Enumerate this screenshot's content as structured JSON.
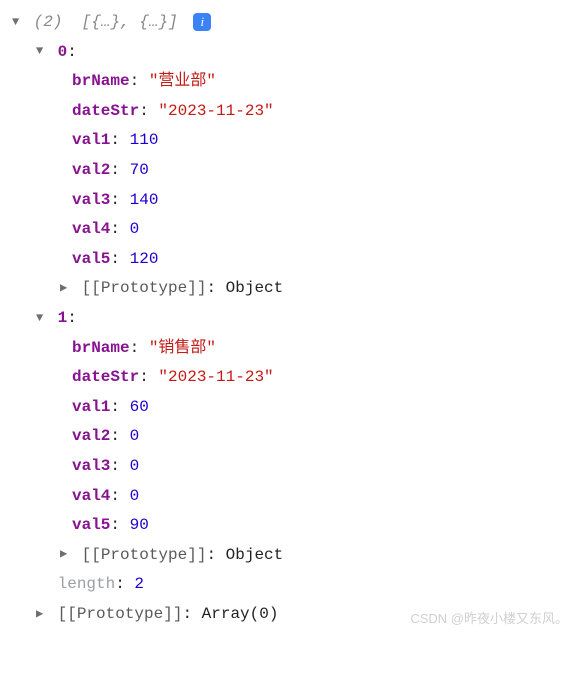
{
  "header": {
    "count_prefix": "(",
    "count": "2",
    "count_suffix": ")",
    "preview": "[{…}, {…}]",
    "info_glyph": "i"
  },
  "items": [
    {
      "index": "0",
      "props": {
        "brName_key": "brName",
        "brName_val": "\"营业部\"",
        "dateStr_key": "dateStr",
        "dateStr_val": "\"2023-11-23\"",
        "val1_key": "val1",
        "val1_val": "110",
        "val2_key": "val2",
        "val2_val": "70",
        "val3_key": "val3",
        "val3_val": "140",
        "val4_key": "val4",
        "val4_val": "0",
        "val5_key": "val5",
        "val5_val": "120"
      },
      "proto_key": "[[Prototype]]",
      "proto_val": "Object"
    },
    {
      "index": "1",
      "props": {
        "brName_key": "brName",
        "brName_val": "\"销售部\"",
        "dateStr_key": "dateStr",
        "dateStr_val": "\"2023-11-23\"",
        "val1_key": "val1",
        "val1_val": "60",
        "val2_key": "val2",
        "val2_val": "0",
        "val3_key": "val3",
        "val3_val": "0",
        "val4_key": "val4",
        "val4_val": "0",
        "val5_key": "val5",
        "val5_val": "90"
      },
      "proto_key": "[[Prototype]]",
      "proto_val": "Object"
    }
  ],
  "length_key": "length",
  "length_val": "2",
  "arr_proto_key": "[[Prototype]]",
  "arr_proto_val": "Array(0)",
  "colon": ": ",
  "watermark": "CSDN @昨夜小楼又东风。"
}
